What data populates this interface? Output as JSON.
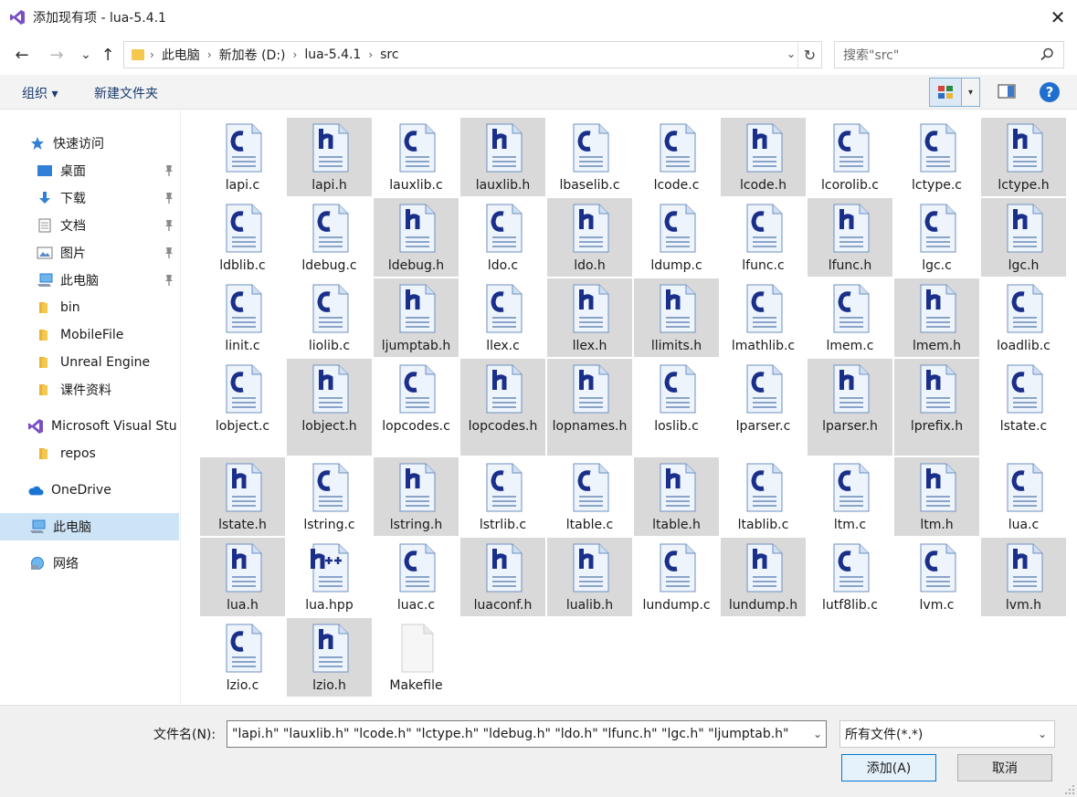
{
  "window": {
    "title": "添加现有项 - lua-5.4.1",
    "close_glyph": "✕"
  },
  "nav": {
    "back_glyph": "←",
    "forward_glyph": "→",
    "recent_glyph": "⌄",
    "up_glyph": "↑"
  },
  "address": {
    "crumbs": [
      "此电脑",
      "新加卷 (D:)",
      "lua-5.4.1",
      "src"
    ],
    "sep_glyph": "›",
    "dropdown_glyph": "⌄",
    "refresh_glyph": "↻"
  },
  "search": {
    "placeholder": "搜索\"src\""
  },
  "toolbar": {
    "organize": "组织 ▾",
    "new_folder": "新建文件夹",
    "view_dd_glyph": "▾",
    "help": "?"
  },
  "sidebar": {
    "items": [
      {
        "label": "快速访问",
        "icon": "star-icon",
        "pinned": false
      },
      {
        "label": "桌面",
        "icon": "desktop-icon",
        "pinned": true
      },
      {
        "label": "下载",
        "icon": "download-icon",
        "pinned": true
      },
      {
        "label": "文档",
        "icon": "document-icon",
        "pinned": true
      },
      {
        "label": "图片",
        "icon": "picture-icon",
        "pinned": true
      },
      {
        "label": "此电脑",
        "icon": "computer-icon",
        "pinned": true
      },
      {
        "label": "bin",
        "icon": "folder-icon",
        "pinned": false
      },
      {
        "label": "MobileFile",
        "icon": "folder-icon",
        "pinned": false
      },
      {
        "label": "Unreal Engine",
        "icon": "folder-icon",
        "pinned": false
      },
      {
        "label": "课件资料",
        "icon": "folder-icon",
        "pinned": false
      },
      {
        "label": "Microsoft Visual Stu",
        "icon": "visual-studio-icon",
        "pinned": false
      },
      {
        "label": "repos",
        "icon": "folder-icon",
        "pinned": false
      },
      {
        "label": "OneDrive",
        "icon": "cloud-icon",
        "pinned": false
      },
      {
        "label": "此电脑",
        "icon": "computer-icon",
        "pinned": false,
        "selected": true
      },
      {
        "label": "网络",
        "icon": "network-icon",
        "pinned": false
      }
    ]
  },
  "files": [
    {
      "name": "lapi.c",
      "type": "c",
      "selected": false
    },
    {
      "name": "lapi.h",
      "type": "h",
      "selected": true
    },
    {
      "name": "lauxlib.c",
      "type": "c",
      "selected": false
    },
    {
      "name": "lauxlib.h",
      "type": "h",
      "selected": true
    },
    {
      "name": "lbaselib.c",
      "type": "c",
      "selected": false
    },
    {
      "name": "lcode.c",
      "type": "c",
      "selected": false
    },
    {
      "name": "lcode.h",
      "type": "h",
      "selected": true
    },
    {
      "name": "lcorolib.c",
      "type": "c",
      "selected": false
    },
    {
      "name": "lctype.c",
      "type": "c",
      "selected": false
    },
    {
      "name": "lctype.h",
      "type": "h",
      "selected": true
    },
    {
      "name": "ldblib.c",
      "type": "c",
      "selected": false
    },
    {
      "name": "ldebug.c",
      "type": "c",
      "selected": false
    },
    {
      "name": "ldebug.h",
      "type": "h",
      "selected": true
    },
    {
      "name": "ldo.c",
      "type": "c",
      "selected": false
    },
    {
      "name": "ldo.h",
      "type": "h",
      "selected": true
    },
    {
      "name": "ldump.c",
      "type": "c",
      "selected": false
    },
    {
      "name": "lfunc.c",
      "type": "c",
      "selected": false
    },
    {
      "name": "lfunc.h",
      "type": "h",
      "selected": true
    },
    {
      "name": "lgc.c",
      "type": "c",
      "selected": false
    },
    {
      "name": "lgc.h",
      "type": "h",
      "selected": true
    },
    {
      "name": "linit.c",
      "type": "c",
      "selected": false
    },
    {
      "name": "liolib.c",
      "type": "c",
      "selected": false
    },
    {
      "name": "ljumptab.h",
      "type": "h",
      "selected": true
    },
    {
      "name": "llex.c",
      "type": "c",
      "selected": false
    },
    {
      "name": "llex.h",
      "type": "h",
      "selected": true
    },
    {
      "name": "llimits.h",
      "type": "h",
      "selected": true
    },
    {
      "name": "lmathlib.c",
      "type": "c",
      "selected": false
    },
    {
      "name": "lmem.c",
      "type": "c",
      "selected": false
    },
    {
      "name": "lmem.h",
      "type": "h",
      "selected": true
    },
    {
      "name": "loadlib.c",
      "type": "c",
      "selected": false
    },
    {
      "name": "lobject.c",
      "type": "c",
      "selected": false
    },
    {
      "name": "lobject.h",
      "type": "h",
      "selected": true
    },
    {
      "name": "lopcodes.c",
      "type": "c",
      "selected": false
    },
    {
      "name": "lopcodes.h",
      "type": "h",
      "selected": true
    },
    {
      "name": "lopnames.h",
      "type": "h",
      "selected": true
    },
    {
      "name": "loslib.c",
      "type": "c",
      "selected": false
    },
    {
      "name": "lparser.c",
      "type": "c",
      "selected": false
    },
    {
      "name": "lparser.h",
      "type": "h",
      "selected": true
    },
    {
      "name": "lprefix.h",
      "type": "h",
      "selected": true
    },
    {
      "name": "lstate.c",
      "type": "c",
      "selected": false
    },
    {
      "name": "lstate.h",
      "type": "h",
      "selected": true
    },
    {
      "name": "lstring.c",
      "type": "c",
      "selected": false
    },
    {
      "name": "lstring.h",
      "type": "h",
      "selected": true
    },
    {
      "name": "lstrlib.c",
      "type": "c",
      "selected": false
    },
    {
      "name": "ltable.c",
      "type": "c",
      "selected": false
    },
    {
      "name": "ltable.h",
      "type": "h",
      "selected": true
    },
    {
      "name": "ltablib.c",
      "type": "c",
      "selected": false
    },
    {
      "name": "ltm.c",
      "type": "c",
      "selected": false
    },
    {
      "name": "ltm.h",
      "type": "h",
      "selected": true
    },
    {
      "name": "lua.c",
      "type": "c",
      "selected": false
    },
    {
      "name": "lua.h",
      "type": "h",
      "selected": true
    },
    {
      "name": "lua.hpp",
      "type": "hpp",
      "selected": false
    },
    {
      "name": "luac.c",
      "type": "c",
      "selected": false
    },
    {
      "name": "luaconf.h",
      "type": "h",
      "selected": true
    },
    {
      "name": "lualib.h",
      "type": "h",
      "selected": true
    },
    {
      "name": "lundump.c",
      "type": "c",
      "selected": false
    },
    {
      "name": "lundump.h",
      "type": "h",
      "selected": true
    },
    {
      "name": "lutf8lib.c",
      "type": "c",
      "selected": false
    },
    {
      "name": "lvm.c",
      "type": "c",
      "selected": false
    },
    {
      "name": "lvm.h",
      "type": "h",
      "selected": true
    },
    {
      "name": "lzio.c",
      "type": "c",
      "selected": false
    },
    {
      "name": "lzio.h",
      "type": "h",
      "selected": true
    },
    {
      "name": "Makefile",
      "type": "blank",
      "selected": false
    }
  ],
  "bottom": {
    "filename_label": "文件名(N):",
    "filename_value": "\"lapi.h\" \"lauxlib.h\" \"lcode.h\" \"lctype.h\" \"ldebug.h\" \"ldo.h\" \"lfunc.h\" \"lgc.h\" \"ljumptab.h\"",
    "filetype_value": "所有文件(*.*)",
    "dropdown_glyph": "⌄",
    "add_button": "添加(A)",
    "cancel_button": "取消"
  },
  "colors": {
    "accent": "#0078d7",
    "selection_gray": "#d9d9d9",
    "icon_letter": "#1a2f8a",
    "help_blue": "#1f6fd1"
  }
}
